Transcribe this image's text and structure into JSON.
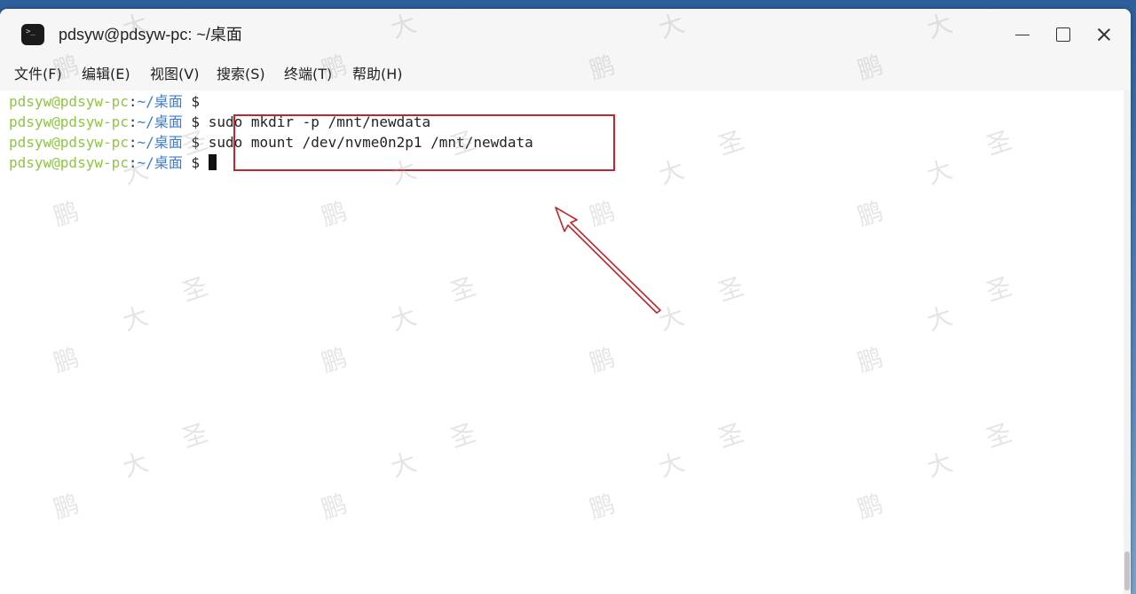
{
  "window": {
    "title": "pdsyw@pdsyw-pc: ~/桌面"
  },
  "menu": {
    "file": "文件(F)",
    "edit": "编辑(E)",
    "view": "视图(V)",
    "search": "搜索(S)",
    "terminal": "终端(T)",
    "help": "帮助(H)"
  },
  "prompt": {
    "user_host": "pdsyw@pdsyw-pc",
    "separator": ":",
    "path": "~/桌面",
    "dollar": "$"
  },
  "lines": [
    {
      "command": ""
    },
    {
      "command": "sudo mkdir -p /mnt/newdata"
    },
    {
      "command": "sudo mount /dev/nvme0n2p1 /mnt/newdata"
    },
    {
      "command": ""
    }
  ],
  "watermark": {
    "chars": [
      "鹏",
      "大",
      "圣"
    ]
  },
  "colors": {
    "prompt_user": "#8dc63f",
    "prompt_path": "#3b7bd6",
    "annotation_red": "#c0262c"
  },
  "icons": {
    "app": "terminal-icon",
    "minimize": "minimize-icon",
    "maximize": "maximize-icon",
    "close": "close-icon"
  }
}
